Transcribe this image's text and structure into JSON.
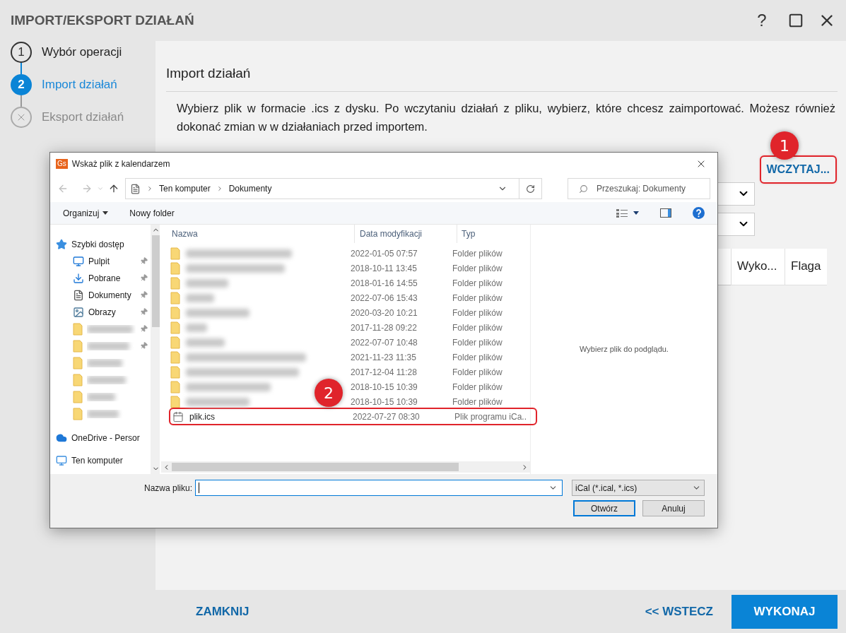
{
  "window": {
    "title": "IMPORT/EKSPORT DZIAŁAŃ",
    "help_label": "?"
  },
  "steps": [
    {
      "number": "1",
      "label": "Wybór operacji",
      "selected": false,
      "disabled": false
    },
    {
      "number": "2",
      "label": "Import działań",
      "selected": true,
      "disabled": false
    },
    {
      "label": "Eksport działań",
      "selected": false,
      "disabled": true
    }
  ],
  "section": {
    "title": "Import działań",
    "description": "Wybierz plik w formacie .ics z dysku. Po wczytaniu działań z pliku, wybierz, które chcesz zaimportować. Możesz również dokonać zmian w w działaniach przed importem."
  },
  "load_button": {
    "label": "WCZYTAJ...",
    "highlighted": true,
    "badge": "1"
  },
  "background_table": {
    "columns": [
      "Wyko...",
      "Flaga"
    ]
  },
  "file_dialog": {
    "title": "Wskaż plik z kalendarzem",
    "app_badge": "Gs",
    "breadcrumb": [
      "Ten komputer",
      "Dokumenty"
    ],
    "search": {
      "placeholder": "Przeszukaj: Dokumenty"
    },
    "toolbar": [
      {
        "label": "Organizuj",
        "kind": "menu"
      },
      {
        "label": "Nowy folder",
        "kind": "button"
      }
    ],
    "nav_items": [
      {
        "kind": "star",
        "label": "Szybki dostęp",
        "pinned": false
      },
      {
        "kind": "desktop",
        "label": "Pulpit",
        "pinned": true
      },
      {
        "kind": "download",
        "label": "Pobrane",
        "pinned": true
      },
      {
        "kind": "document",
        "label": "Dokumenty",
        "pinned": true
      },
      {
        "kind": "image",
        "label": "Obrazy",
        "pinned": true
      },
      {
        "kind": "folder",
        "pinned": true
      },
      {
        "kind": "folder",
        "pinned": true
      },
      {
        "kind": "folder",
        "pinned": false
      },
      {
        "kind": "folder",
        "pinned": false
      },
      {
        "kind": "folder",
        "pinned": false
      },
      {
        "kind": "folder",
        "pinned": false
      },
      {
        "kind": "cloud",
        "label": "OneDrive - Persor",
        "pinned": false
      },
      {
        "kind": "computer",
        "label": "Ten komputer",
        "pinned": false
      }
    ],
    "columns": [
      "Nazwa",
      "Data modyfikacji",
      "Typ"
    ],
    "rows": [
      {
        "kind": "folder",
        "date": "2022-01-05 07:57",
        "type": "Folder plików",
        "highlighted": false
      },
      {
        "kind": "folder",
        "date": "2018-10-11 13:45",
        "type": "Folder plików",
        "highlighted": false
      },
      {
        "kind": "folder",
        "date": "2018-01-16 14:55",
        "type": "Folder plików",
        "highlighted": false
      },
      {
        "kind": "folder",
        "date": "2022-07-06 15:43",
        "type": "Folder plików",
        "highlighted": false
      },
      {
        "kind": "folder",
        "date": "2020-03-20 10:21",
        "type": "Folder plików",
        "highlighted": false
      },
      {
        "kind": "folder",
        "date": "2017-11-28 09:22",
        "type": "Folder plików",
        "highlighted": false
      },
      {
        "kind": "folder",
        "date": "2022-07-07 10:48",
        "type": "Folder plików",
        "highlighted": false
      },
      {
        "kind": "folder",
        "date": "2021-11-23 11:35",
        "type": "Folder plików",
        "highlighted": false
      },
      {
        "kind": "folder",
        "date": "2017-12-04 11:28",
        "type": "Folder plików",
        "highlighted": false
      },
      {
        "kind": "folder",
        "date": "2018-10-15 10:39",
        "type": "Folder plików",
        "highlighted": false
      },
      {
        "kind": "folder",
        "date": "2018-10-15 10:39",
        "type": "Folder plików",
        "highlighted": false
      },
      {
        "kind": "calendar",
        "name": "plik.ics",
        "date": "2022-07-27 08:30",
        "type": "Plik programu iCa..",
        "highlighted": true
      }
    ],
    "row_badge": "2",
    "preview_text": "Wybierz plik do podglądu.",
    "filename_label": "Nazwa pliku:",
    "filter": "iCal (*.ical, *.ics)",
    "buttons": [
      {
        "label": "Otwórz",
        "kind": "default"
      },
      {
        "label": "Anuluj",
        "kind": "normal"
      }
    ]
  },
  "footer": {
    "close": "ZAMKNIJ",
    "back": "<< WSTECZ",
    "run": "WYKONAJ"
  }
}
